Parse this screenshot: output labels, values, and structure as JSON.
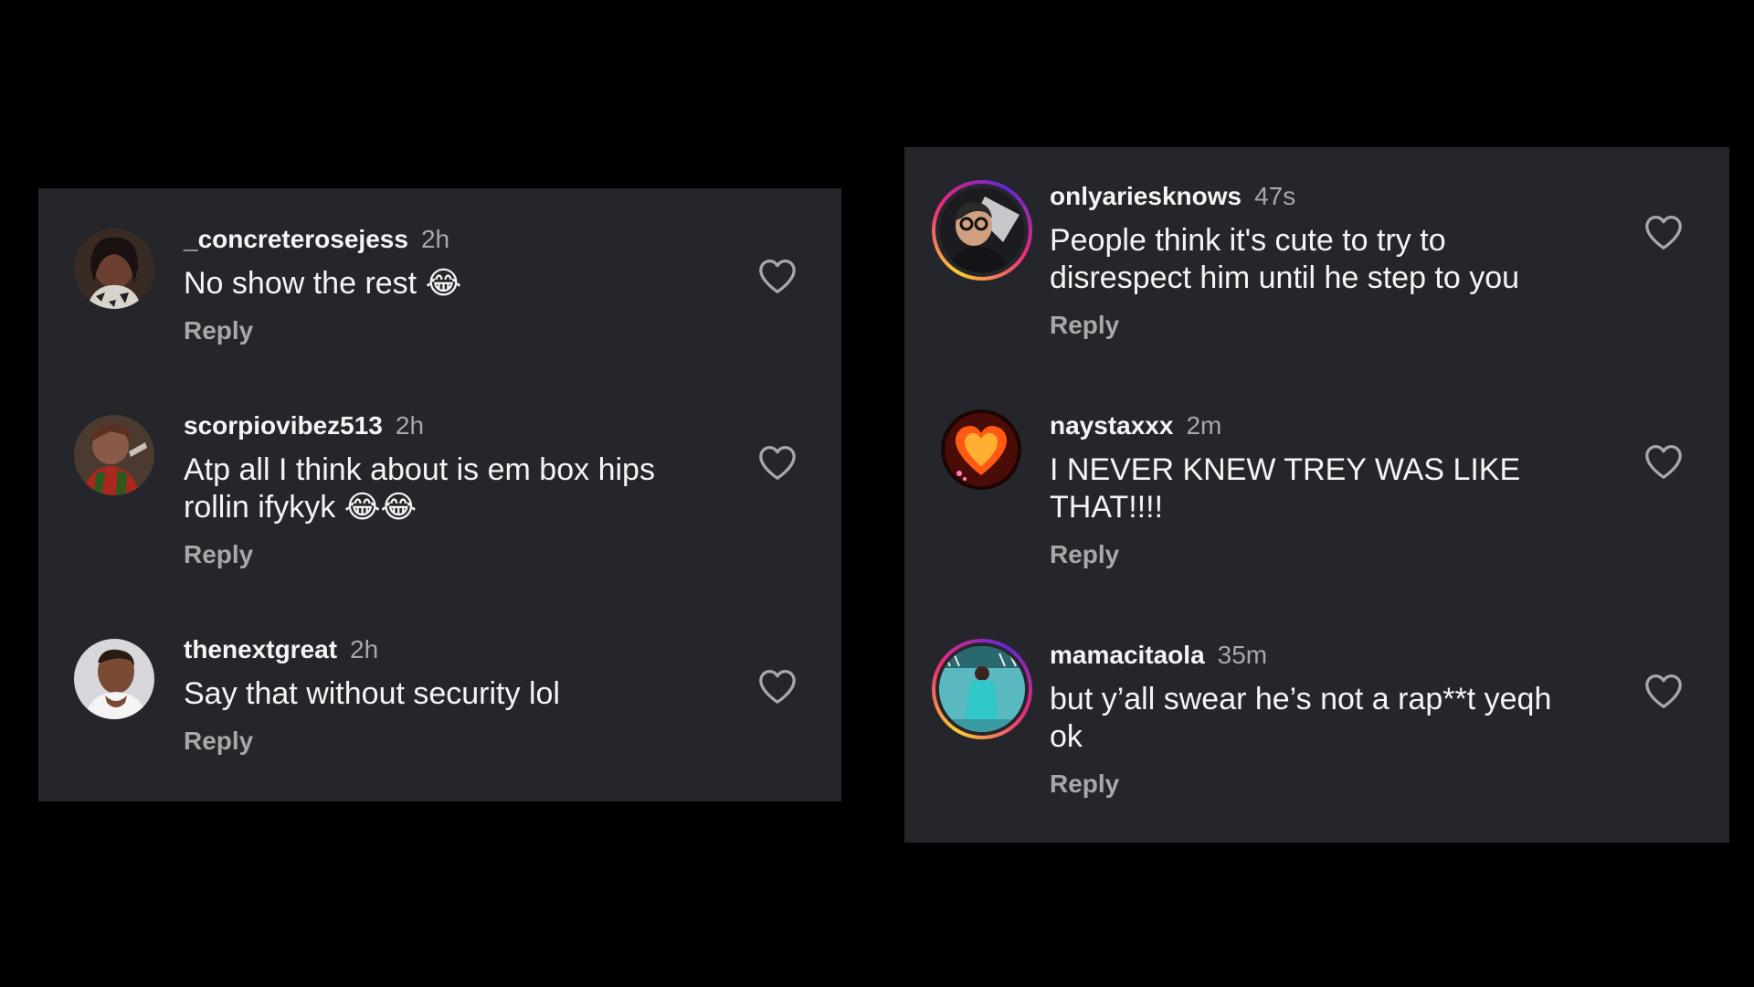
{
  "left_panel": {
    "comments": [
      {
        "username": "_concreterosejess",
        "time": "2h",
        "text": "No show the rest 😂",
        "reply_label": "Reply"
      },
      {
        "username": "scorpiovibez513",
        "time": "2h",
        "text": "Atp all I think about is em box hips rollin ifykyk 😂😂",
        "reply_label": "Reply"
      },
      {
        "username": "thenextgreat",
        "time": "2h",
        "text": "Say that without security lol",
        "reply_label": "Reply"
      }
    ]
  },
  "right_panel": {
    "comments": [
      {
        "username": "onlyariesknows",
        "time": "47s",
        "text": "People think it's cute to try to disrespect him until he step to you",
        "reply_label": "Reply"
      },
      {
        "username": "naystaxxx",
        "time": "2m",
        "text": "I NEVER KNEW TREY WAS LIKE THAT!!!!",
        "reply_label": "Reply"
      },
      {
        "username": "mamacitaola",
        "time": "35m",
        "text": "but y’all swear he’s not a rap**t yeqh ok",
        "reply_label": "Reply"
      }
    ]
  },
  "icons": {
    "like": "heart-outline-icon"
  },
  "colors": {
    "background": "#000000",
    "panel": "#25262b",
    "primary_text": "#f5f5f5",
    "secondary_text": "#a8a8a8",
    "story_ring": [
      "#f9ce34",
      "#ee2a7b",
      "#6228d7"
    ]
  }
}
